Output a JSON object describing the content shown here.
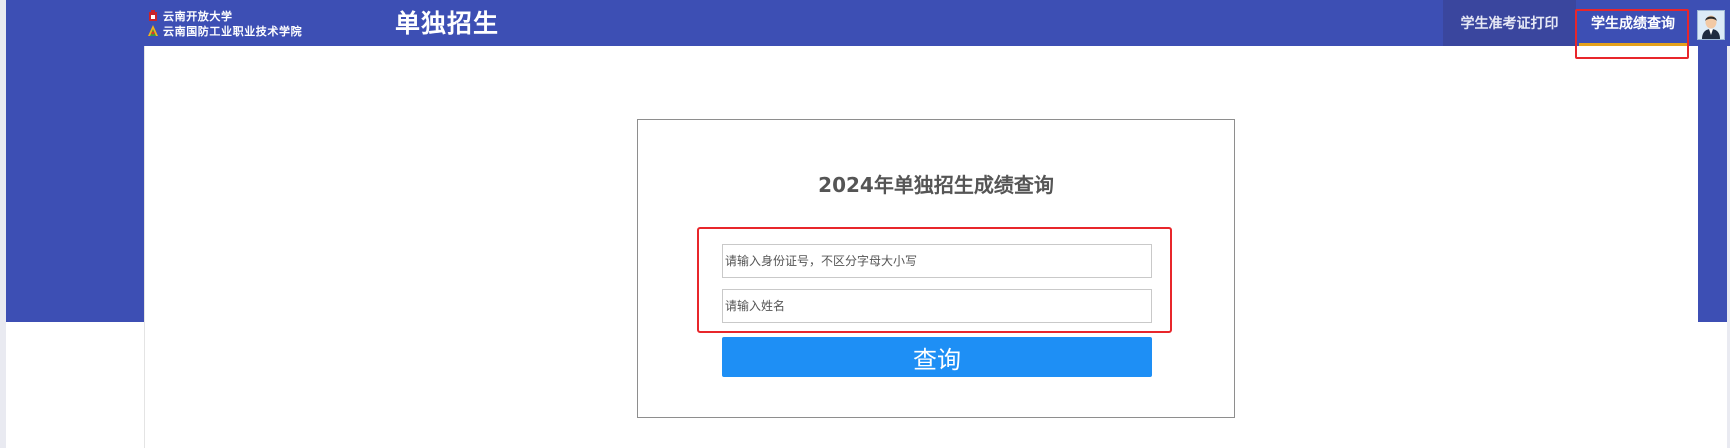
{
  "header": {
    "logo_line1": "云南开放大学",
    "logo_line2": "云南国防工业职业技术学院",
    "title": "单独招生",
    "nav": [
      {
        "label": "学生准考证打印",
        "active": false
      },
      {
        "label": "学生成绩查询",
        "active": true
      }
    ],
    "avatar_icon": "user-avatar-icon"
  },
  "form": {
    "title": "2024年单独招生成绩查询",
    "id_placeholder": "请输入身份证号，不区分字母大小写",
    "id_value": "",
    "name_placeholder": "请输入姓名",
    "name_value": "",
    "submit_label": "查询"
  },
  "colors": {
    "primary_blue": "#3d4fb4",
    "button_blue": "#1e8ff5",
    "active_underline": "#e5a21b",
    "highlight_red": "#e8262b"
  }
}
